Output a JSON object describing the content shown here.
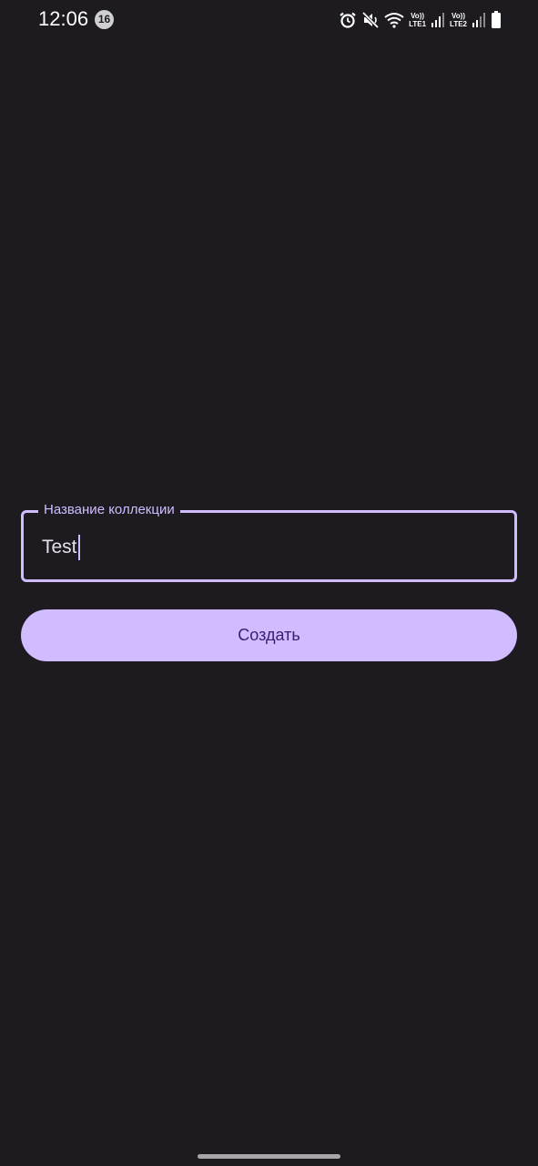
{
  "status_bar": {
    "time": "12:06",
    "notification_count": "16",
    "sim1_label_top": "Vo))",
    "sim1_label_bottom": "LTE1",
    "sim2_label_top": "Vo))",
    "sim2_label_bottom": "LTE2",
    "icons": [
      "alarm-icon",
      "mute-icon",
      "wifi-icon",
      "signal-icon",
      "signal-icon",
      "battery-icon"
    ]
  },
  "form": {
    "collection_name_label": "Название коллекции",
    "collection_name_value": "Test",
    "create_label": "Создать"
  },
  "colors": {
    "background": "#1d1b20",
    "accent": "#d0bcff",
    "button_text": "#381e72"
  }
}
